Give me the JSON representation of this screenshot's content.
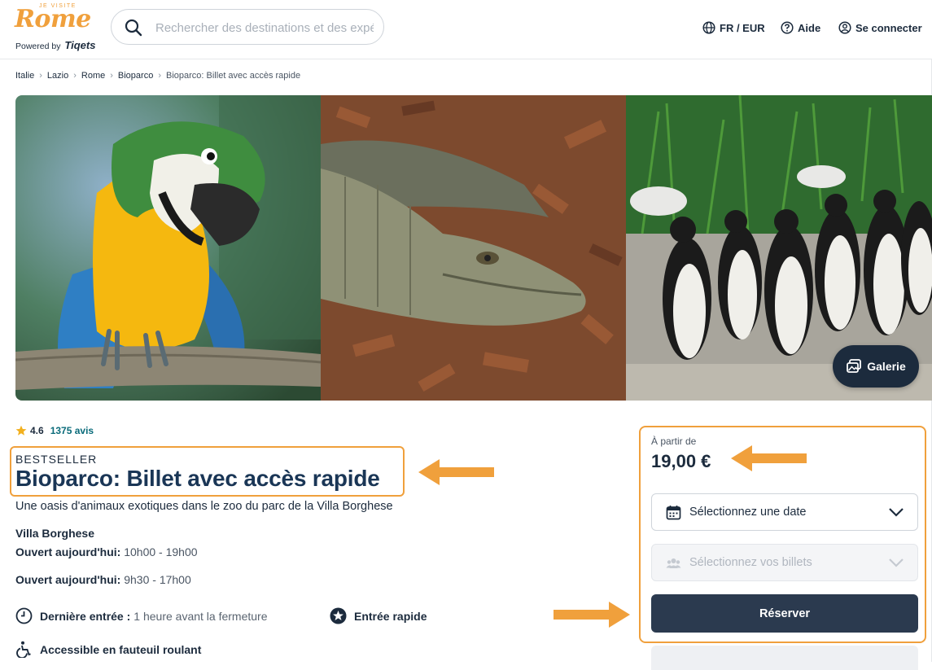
{
  "header": {
    "logo_top": "JE VISITE",
    "logo_name": "Rome",
    "logo_powered": "Powered by",
    "logo_brand": "Tiqets",
    "search_placeholder": "Rechercher des destinations et des expériences",
    "lang_label": "FR / EUR",
    "help_label": "Aide",
    "login_label": "Se connecter"
  },
  "breadcrumb": [
    "Italie",
    "Lazio",
    "Rome",
    "Bioparco",
    "Bioparco: Billet avec accès rapide"
  ],
  "gallery": {
    "photos": [
      "parrot",
      "crocodile",
      "penguins"
    ],
    "button_label": "Galerie"
  },
  "product": {
    "rating": "4.6",
    "reviews": "1375 avis",
    "badge": "BESTSELLER",
    "title": "Bioparco: Billet avec accès rapide",
    "subtitle": "Une oasis d'animaux exotiques dans le zoo du parc de la Villa Borghese",
    "location": "Villa Borghese",
    "hours": [
      {
        "label": "Ouvert aujourd'hui:",
        "value": "10h00 - 19h00"
      },
      {
        "label": "Ouvert aujourd'hui:",
        "value": "9h30 - 17h00"
      }
    ],
    "features": [
      {
        "label": "Dernière entrée :",
        "value": "1 heure avant la fermeture",
        "icon": "clock-icon"
      },
      {
        "label": "Entrée rapide",
        "value": "",
        "icon": "star-badge-icon"
      },
      {
        "label": "Accessible en fauteuil roulant",
        "value": "",
        "icon": "wheelchair-icon"
      }
    ]
  },
  "booking": {
    "price_from": "À partir de",
    "price": "19,00 €",
    "date_placeholder": "Sélectionnez une date",
    "tickets_placeholder": "Sélectionnez vos billets",
    "reserve_label": "Réserver"
  },
  "colors": {
    "accent": "#f0a03c",
    "navy": "#1c2b3d",
    "teal": "#0a6b7a",
    "button": "#2b3a4f"
  }
}
